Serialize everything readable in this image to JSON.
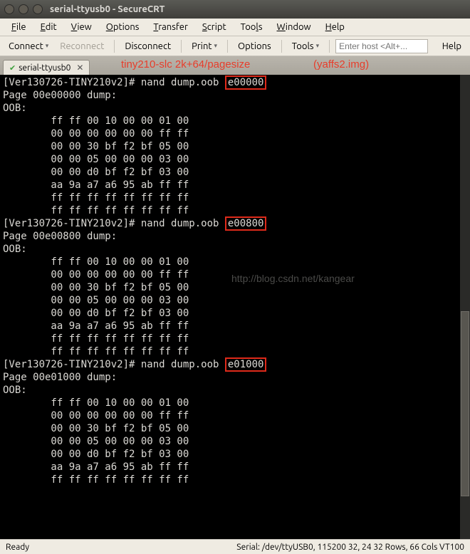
{
  "window": {
    "title": "serial-ttyusb0 - SecureCRT"
  },
  "menu": {
    "file": "File",
    "edit": "Edit",
    "view": "View",
    "options": "Options",
    "transfer": "Transfer",
    "script": "Script",
    "tools": "Tools",
    "window": "Window",
    "help": "Help"
  },
  "toolbar": {
    "connect": "Connect",
    "reconnect": "Reconnect",
    "disconnect": "Disconnect",
    "print": "Print",
    "options": "Options",
    "tools": "Tools",
    "host_ph": "Enter host <Alt+...",
    "help": "Help"
  },
  "tab": {
    "name": "serial-ttyusb0"
  },
  "annot": {
    "a": "tiny210-slc  2k+64/pagesize",
    "b": "(yaffs2.img)"
  },
  "term": {
    "p1": "[Ver130726-TINY210v2]# nand dump.oob ",
    "a1": "e00000",
    "p1b": "Page 00e00000 dump:",
    "oob": "OOB:",
    "h1": "        ff ff 00 10 00 00 01 00",
    "h2": "        00 00 00 00 00 00 ff ff",
    "h3": "        00 00 30 bf f2 bf 05 00",
    "h4": "        00 00 05 00 00 00 03 00",
    "h5": "        00 00 d0 bf f2 bf 03 00",
    "h6": "        aa 9a a7 a6 95 ab ff ff",
    "h7": "        ff ff ff ff ff ff ff ff",
    "h8": "        ff ff ff ff ff ff ff ff",
    "p2": "[Ver130726-TINY210v2]# nand dump.oob ",
    "a2": "e00800",
    "p2b": "Page 00e00800 dump:",
    "p3": "[Ver130726-TINY210v2]# nand dump.oob ",
    "a3": "e01000",
    "p3b": "Page 00e01000 dump:",
    "wm": "http://blog.csdn.net/kangear"
  },
  "status": {
    "left": "Ready",
    "right": "Serial: /dev/ttyUSB0, 115200  32, 24  32 Rows, 66 Cols  VT100"
  }
}
